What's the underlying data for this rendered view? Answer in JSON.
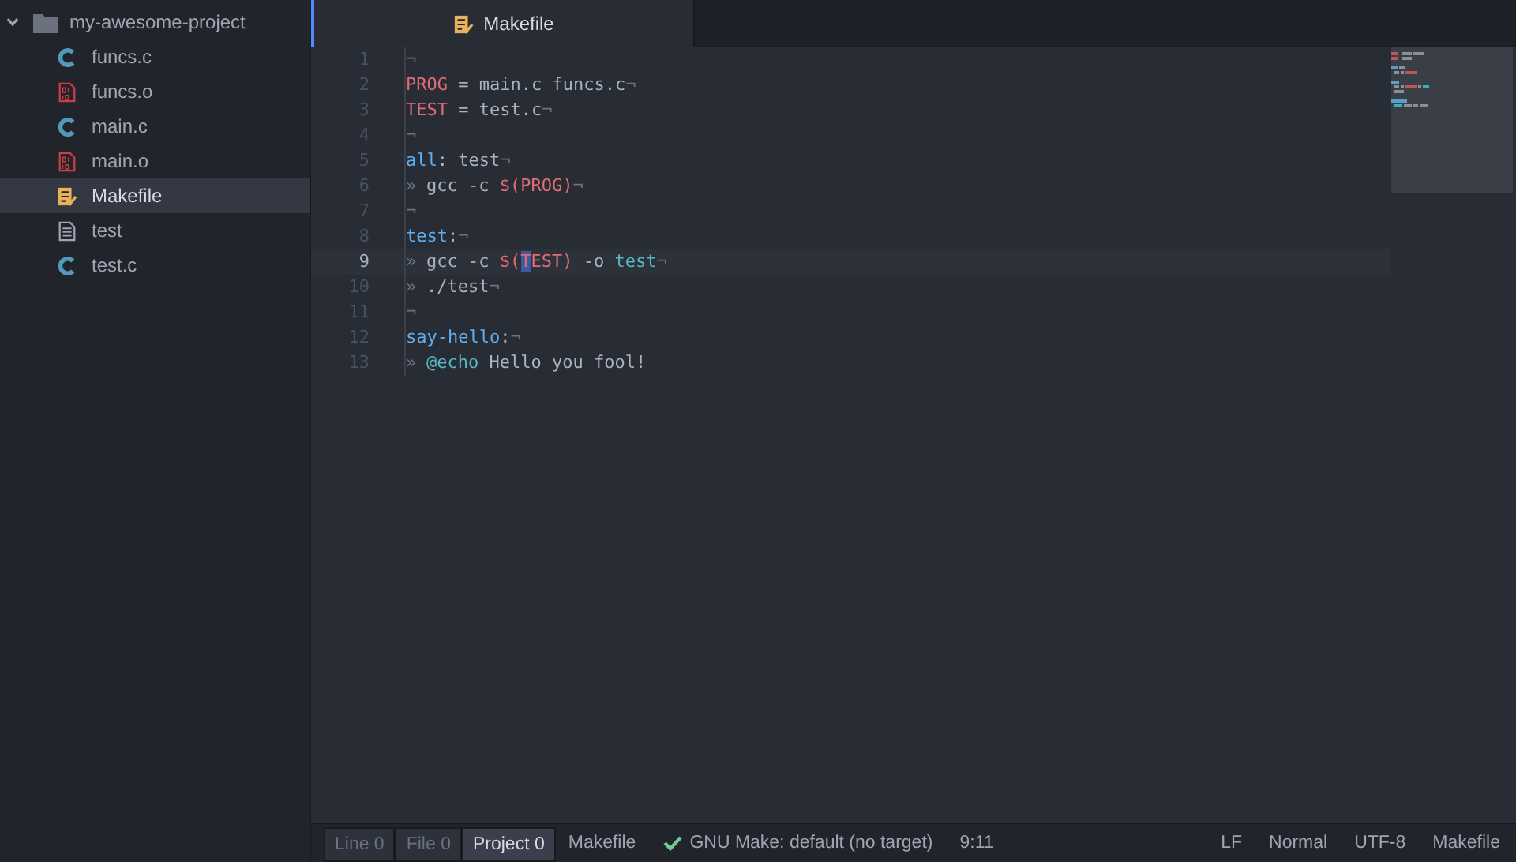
{
  "sidebar": {
    "root": {
      "name": "my-awesome-project",
      "expanded": true,
      "children": [
        {
          "name": "funcs.c",
          "kind": "c",
          "selected": false
        },
        {
          "name": "funcs.o",
          "kind": "binary",
          "selected": false
        },
        {
          "name": "main.c",
          "kind": "c",
          "selected": false
        },
        {
          "name": "main.o",
          "kind": "binary",
          "selected": false
        },
        {
          "name": "Makefile",
          "kind": "makefile",
          "selected": true
        },
        {
          "name": "test",
          "kind": "text",
          "selected": false
        },
        {
          "name": "test.c",
          "kind": "c",
          "selected": false
        }
      ]
    }
  },
  "tabs": [
    {
      "label": "Makefile",
      "kind": "makefile",
      "selected": true
    }
  ],
  "editor": {
    "lines": [
      {
        "number": "1",
        "current": false,
        "tokens": [
          {
            "kind": "invisible",
            "text": "¬"
          }
        ]
      },
      {
        "number": "2",
        "current": false,
        "tokens": [
          {
            "kind": "variable",
            "text": "PROG"
          },
          {
            "kind": "plain",
            "text": " = main.c funcs.c"
          },
          {
            "kind": "invisible",
            "text": "¬"
          }
        ]
      },
      {
        "number": "3",
        "current": false,
        "tokens": [
          {
            "kind": "variable",
            "text": "TEST"
          },
          {
            "kind": "plain",
            "text": " = test.c"
          },
          {
            "kind": "invisible",
            "text": "¬"
          }
        ]
      },
      {
        "number": "4",
        "current": false,
        "tokens": [
          {
            "kind": "invisible",
            "text": "¬"
          }
        ]
      },
      {
        "number": "5",
        "current": false,
        "tokens": [
          {
            "kind": "target",
            "text": "all"
          },
          {
            "kind": "plain",
            "text": ": test"
          },
          {
            "kind": "invisible",
            "text": "¬"
          }
        ]
      },
      {
        "number": "6",
        "current": false,
        "tokens": [
          {
            "kind": "tab",
            "text": "»"
          },
          {
            "kind": "plain",
            "text": "gcc -c "
          },
          {
            "kind": "variable",
            "text": "$(PROG)"
          },
          {
            "kind": "invisible",
            "text": "¬"
          }
        ]
      },
      {
        "number": "7",
        "current": false,
        "tokens": [
          {
            "kind": "invisible",
            "text": "¬"
          }
        ]
      },
      {
        "number": "8",
        "current": false,
        "tokens": [
          {
            "kind": "target",
            "text": "test"
          },
          {
            "kind": "plain",
            "text": ":"
          },
          {
            "kind": "invisible",
            "text": "¬"
          }
        ]
      },
      {
        "number": "9",
        "current": true,
        "tokens": [
          {
            "kind": "tab",
            "text": "»"
          },
          {
            "kind": "plain",
            "text": "gcc -c "
          },
          {
            "kind": "variable",
            "text": "$("
          },
          {
            "kind": "cursor",
            "text": "T"
          },
          {
            "kind": "variable",
            "text": "EST)"
          },
          {
            "kind": "plain",
            "text": " -o "
          },
          {
            "kind": "builtin",
            "text": "test"
          },
          {
            "kind": "invisible",
            "text": "¬"
          }
        ]
      },
      {
        "number": "10",
        "current": false,
        "tokens": [
          {
            "kind": "tab",
            "text": "»"
          },
          {
            "kind": "plain",
            "text": "./test"
          },
          {
            "kind": "invisible",
            "text": "¬"
          }
        ]
      },
      {
        "number": "11",
        "current": false,
        "tokens": [
          {
            "kind": "invisible",
            "text": "¬"
          }
        ]
      },
      {
        "number": "12",
        "current": false,
        "tokens": [
          {
            "kind": "target",
            "text": "say-hello"
          },
          {
            "kind": "plain",
            "text": ":"
          },
          {
            "kind": "invisible",
            "text": "¬"
          }
        ]
      },
      {
        "number": "13",
        "current": false,
        "tokens": [
          {
            "kind": "tab",
            "text": "»"
          },
          {
            "kind": "builtin",
            "text": "@echo"
          },
          {
            "kind": "plain",
            "text": " Hello you fool!"
          }
        ]
      }
    ]
  },
  "status_bar": {
    "counters": [
      {
        "label": "Line",
        "count": "0",
        "selected": false
      },
      {
        "label": "File",
        "count": "0",
        "selected": false
      },
      {
        "label": "Project",
        "count": "0",
        "selected": true
      }
    ],
    "grammar_file": "Makefile",
    "build": {
      "ok": true,
      "text": "GNU Make: default (no target)"
    },
    "cursor": "9:11",
    "right": [
      "LF",
      "Normal",
      "UTF-8",
      "Makefile"
    ]
  }
}
